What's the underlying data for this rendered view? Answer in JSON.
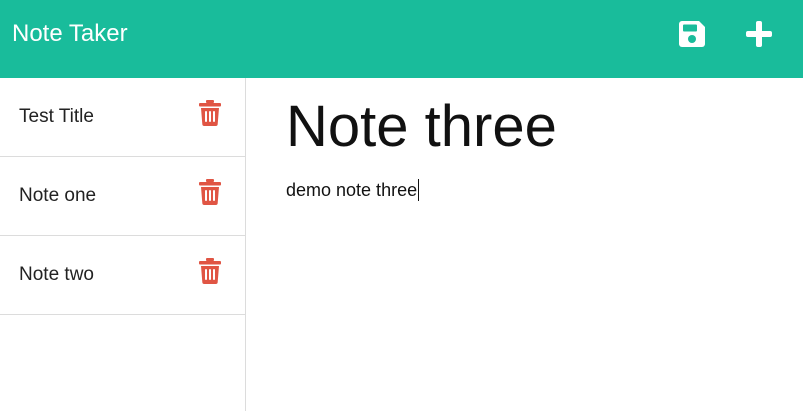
{
  "navbar": {
    "brand": "Note Taker",
    "background": "#19bc9b",
    "actions": [
      {
        "name": "save",
        "icon": "floppy-disk-icon"
      },
      {
        "name": "add",
        "icon": "plus-icon"
      }
    ]
  },
  "sidebar": {
    "items": [
      {
        "label": "Test Title",
        "icon": "trash-icon"
      },
      {
        "label": "Note one",
        "icon": "trash-icon"
      },
      {
        "label": "Note two",
        "icon": "trash-icon"
      }
    ],
    "delete_color": "#e05544"
  },
  "editor": {
    "title": "Note three",
    "body": "demo note three"
  }
}
